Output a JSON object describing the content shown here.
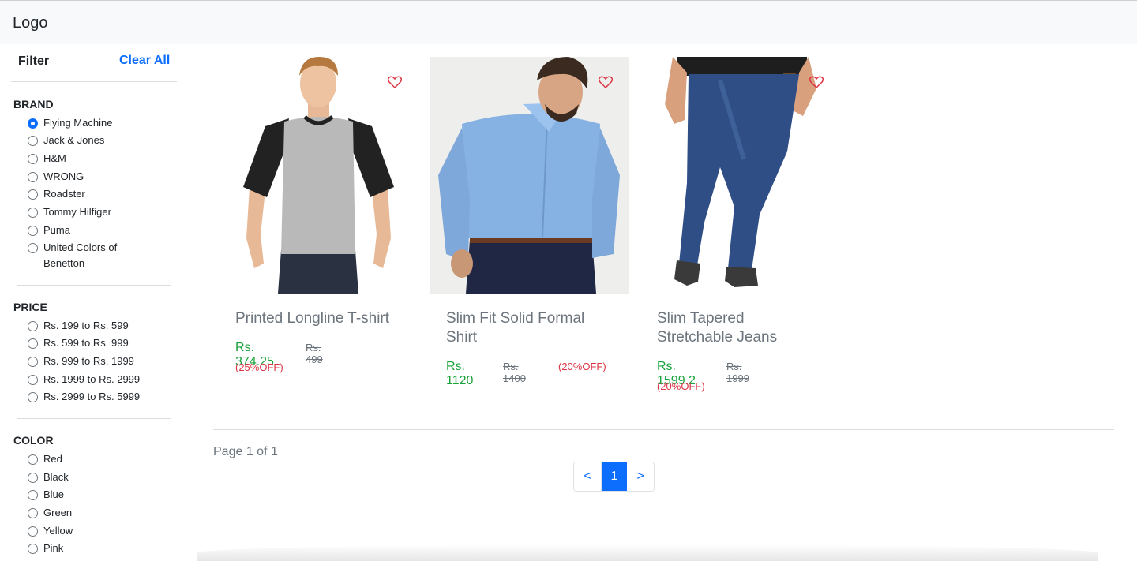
{
  "header": {
    "logo": "Logo"
  },
  "sidebar": {
    "title": "Filter",
    "clear_all": "Clear All",
    "brand": {
      "title": "BRAND",
      "options": [
        {
          "label": "Flying Machine",
          "checked": true
        },
        {
          "label": "Jack & Jones",
          "checked": false
        },
        {
          "label": "H&M",
          "checked": false
        },
        {
          "label": "WRONG",
          "checked": false
        },
        {
          "label": "Roadster",
          "checked": false
        },
        {
          "label": "Tommy Hilfiger",
          "checked": false
        },
        {
          "label": "Puma",
          "checked": false
        },
        {
          "label": "United Colors of Benetton",
          "checked": false
        }
      ]
    },
    "price": {
      "title": "PRICE",
      "options": [
        {
          "label": "Rs. 199 to Rs. 599"
        },
        {
          "label": "Rs. 599 to Rs. 999"
        },
        {
          "label": "Rs. 999 to Rs. 1999"
        },
        {
          "label": "Rs. 1999 to Rs. 2999"
        },
        {
          "label": "Rs. 2999 to Rs. 5999"
        }
      ]
    },
    "color": {
      "title": "COLOR",
      "options": [
        {
          "label": "Red"
        },
        {
          "label": "Black"
        },
        {
          "label": "Blue"
        },
        {
          "label": "Green"
        },
        {
          "label": "Yellow"
        },
        {
          "label": "Pink"
        }
      ]
    }
  },
  "products": [
    {
      "title": "Printed Longline T-shirt",
      "price": "Rs. 374.25",
      "mrp": "Rs. 499",
      "off": "(25%OFF)",
      "image": "tshirt-photo"
    },
    {
      "title": "Slim Fit Solid Formal Shirt",
      "price": "Rs. 1120",
      "mrp": "Rs. 1400",
      "off": "(20%OFF)",
      "image": "formal-shirt-photo"
    },
    {
      "title": "Slim Tapered Stretchable Jeans",
      "price": "Rs. 1599.2",
      "mrp": "Rs. 1999",
      "off": "(20%OFF)",
      "image": "jeans-photo"
    }
  ],
  "pagination": {
    "info": "Page 1 of 1",
    "prev": "<",
    "current": "1",
    "next": ">"
  },
  "colors": {
    "accent": "#0d6efd",
    "price": "#1aa33b",
    "discount": "#dc3545",
    "heart": "#dc3545"
  }
}
